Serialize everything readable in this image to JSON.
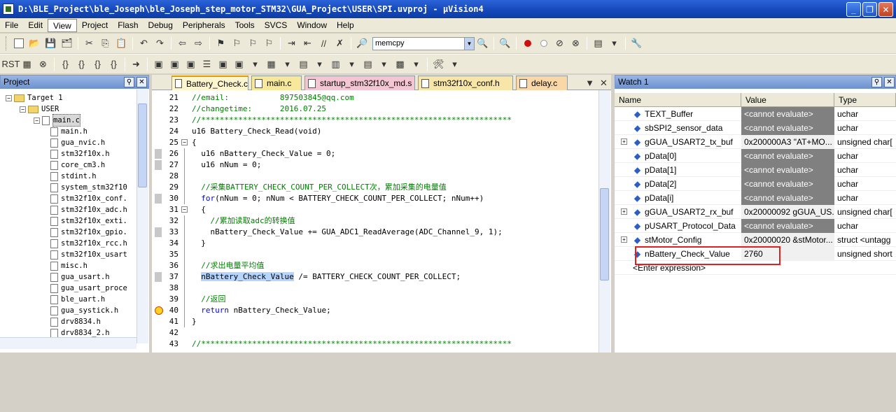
{
  "window": {
    "title": "D:\\BLE_Project\\ble_Joseph\\ble_Joseph_step_motor_STM32\\GUA_Project\\USER\\SPI.uvproj - µVision4",
    "controls": [
      "_",
      "❐",
      "✕"
    ]
  },
  "menu": [
    "File",
    "Edit",
    "View",
    "Project",
    "Flash",
    "Debug",
    "Peripherals",
    "Tools",
    "SVCS",
    "Window",
    "Help"
  ],
  "toolbar": {
    "find_value": "memcpy"
  },
  "project": {
    "title": "Project",
    "tree": [
      {
        "label": "Target 1",
        "level": 0,
        "kind": "folder"
      },
      {
        "label": "USER",
        "level": 1,
        "kind": "folder"
      },
      {
        "label": "main.c",
        "level": 2,
        "kind": "file"
      },
      {
        "label": "main.h",
        "level": 3,
        "kind": "header"
      },
      {
        "label": "gua_nvic.h",
        "level": 3,
        "kind": "header"
      },
      {
        "label": "stm32f10x.h",
        "level": 3,
        "kind": "header"
      },
      {
        "label": "core_cm3.h",
        "level": 3,
        "kind": "header"
      },
      {
        "label": "stdint.h",
        "level": 3,
        "kind": "header"
      },
      {
        "label": "system_stm32f10",
        "level": 3,
        "kind": "header"
      },
      {
        "label": "stm32f10x_conf.",
        "level": 3,
        "kind": "header"
      },
      {
        "label": "stm32f10x_adc.h",
        "level": 3,
        "kind": "header"
      },
      {
        "label": "stm32f10x_exti.",
        "level": 3,
        "kind": "header"
      },
      {
        "label": "stm32f10x_gpio.",
        "level": 3,
        "kind": "header"
      },
      {
        "label": "stm32f10x_rcc.h",
        "level": 3,
        "kind": "header"
      },
      {
        "label": "stm32f10x_usart",
        "level": 3,
        "kind": "header"
      },
      {
        "label": "misc.h",
        "level": 3,
        "kind": "header"
      },
      {
        "label": "gua_usart.h",
        "level": 3,
        "kind": "header"
      },
      {
        "label": "gua_usart_proce",
        "level": 3,
        "kind": "header"
      },
      {
        "label": "ble_uart.h",
        "level": 3,
        "kind": "header"
      },
      {
        "label": "gua_systick.h",
        "level": 3,
        "kind": "header"
      },
      {
        "label": "drv8834.h",
        "level": 3,
        "kind": "header"
      },
      {
        "label": "drv8834_2.h",
        "level": 3,
        "kind": "header"
      }
    ]
  },
  "editor": {
    "tabs": [
      {
        "label": "Battery_Check.c",
        "active": true,
        "color": "#ffe9a8"
      },
      {
        "label": "main.c",
        "active": false,
        "color": "#f7e89c"
      },
      {
        "label": "startup_stm32f10x_md.s",
        "active": false,
        "color": "#f4c6d2"
      },
      {
        "label": "stm32f10x_conf.h",
        "active": false,
        "color": "#f7e6a8"
      },
      {
        "label": "delay.c",
        "active": false,
        "color": "#f9d7a6"
      }
    ],
    "lines": [
      {
        "n": "21",
        "text": "//email:           897503845@qq.com",
        "type": "cmt"
      },
      {
        "n": "22",
        "text": "//changetime:      2016.07.25",
        "type": "cmt"
      },
      {
        "n": "23",
        "text": "//*******************************************************************",
        "type": "cmt"
      },
      {
        "n": "24",
        "text": "u16 Battery_Check_Read(void)",
        "type": "code"
      },
      {
        "n": "25",
        "text": "{",
        "type": "code",
        "fold": "-"
      },
      {
        "n": "26",
        "text": "  u16 nBattery_Check_Value = 0;",
        "type": "code",
        "mark": true
      },
      {
        "n": "27",
        "text": "  u16 nNum = 0;",
        "type": "code",
        "mark": true
      },
      {
        "n": "28",
        "text": "",
        "type": "code"
      },
      {
        "n": "29",
        "text": "  //采集BATTERY_CHECK_COUNT_PER_COLLECT次，累加采集的电量值",
        "type": "cmt"
      },
      {
        "n": "30",
        "text": "  for(nNum = 0; nNum < BATTERY_CHECK_COUNT_PER_COLLECT; nNum++)",
        "type": "kwline",
        "mark": true
      },
      {
        "n": "31",
        "text": "  {",
        "type": "code",
        "fold": "-"
      },
      {
        "n": "32",
        "text": "    //累加读取adc的转换值",
        "type": "cmt"
      },
      {
        "n": "33",
        "text": "    nBattery_Check_Value += GUA_ADC1_ReadAverage(ADC_Channel_9, 1);",
        "type": "code",
        "mark": true
      },
      {
        "n": "34",
        "text": "  }",
        "type": "code"
      },
      {
        "n": "35",
        "text": "",
        "type": "code"
      },
      {
        "n": "36",
        "text": "  //求出电量平均值",
        "type": "cmt"
      },
      {
        "n": "37",
        "text": "  nBattery_Check_Value /= BATTERY_CHECK_COUNT_PER_COLLECT;",
        "type": "hlline",
        "mark": true
      },
      {
        "n": "38",
        "text": "",
        "type": "code"
      },
      {
        "n": "39",
        "text": "  //返回",
        "type": "cmt"
      },
      {
        "n": "40",
        "text": "  return nBattery_Check_Value;",
        "type": "retline",
        "arrow": true
      },
      {
        "n": "41",
        "text": "}",
        "type": "code"
      },
      {
        "n": "42",
        "text": "",
        "type": "code"
      },
      {
        "n": "43",
        "text": "//*******************************************************************",
        "type": "cmt"
      }
    ]
  },
  "watch": {
    "title": "Watch 1",
    "columns": [
      "Name",
      "Value",
      "Type"
    ],
    "rows": [
      {
        "name": "TEXT_Buffer",
        "value": "<cannot evaluate>",
        "type": "uchar",
        "grey": true,
        "expand": false
      },
      {
        "name": "sbSPI2_sensor_data",
        "value": "<cannot evaluate>",
        "type": "uchar",
        "grey": true,
        "expand": false
      },
      {
        "name": "gGUA_USART2_tx_buf",
        "value": "0x200000A3 \"AT+MO...",
        "type": "unsigned char[",
        "grey": false,
        "expand": true
      },
      {
        "name": "pData[0]",
        "value": "<cannot evaluate>",
        "type": "uchar",
        "grey": true,
        "expand": false
      },
      {
        "name": "pData[1]",
        "value": "<cannot evaluate>",
        "type": "uchar",
        "grey": true,
        "expand": false
      },
      {
        "name": "pData[2]",
        "value": "<cannot evaluate>",
        "type": "uchar",
        "grey": true,
        "expand": false
      },
      {
        "name": "pData[i]",
        "value": "<cannot evaluate>",
        "type": "uchar",
        "grey": true,
        "expand": false
      },
      {
        "name": "gGUA_USART2_rx_buf",
        "value": "0x20000092 gGUA_US...",
        "type": "unsigned char[",
        "grey": false,
        "expand": true
      },
      {
        "name": "pUSART_Protocol_Data",
        "value": "<cannot evaluate>",
        "type": "uchar",
        "grey": true,
        "expand": false
      },
      {
        "name": "stMotor_Config",
        "value": "0x20000020 &stMotor...",
        "type": "struct <untagg",
        "grey": false,
        "expand": true
      },
      {
        "name": "nBattery_Check_Value",
        "value": "2760",
        "type": "unsigned short",
        "grey": false,
        "expand": false
      }
    ],
    "enter_expression": "<Enter expression>"
  }
}
